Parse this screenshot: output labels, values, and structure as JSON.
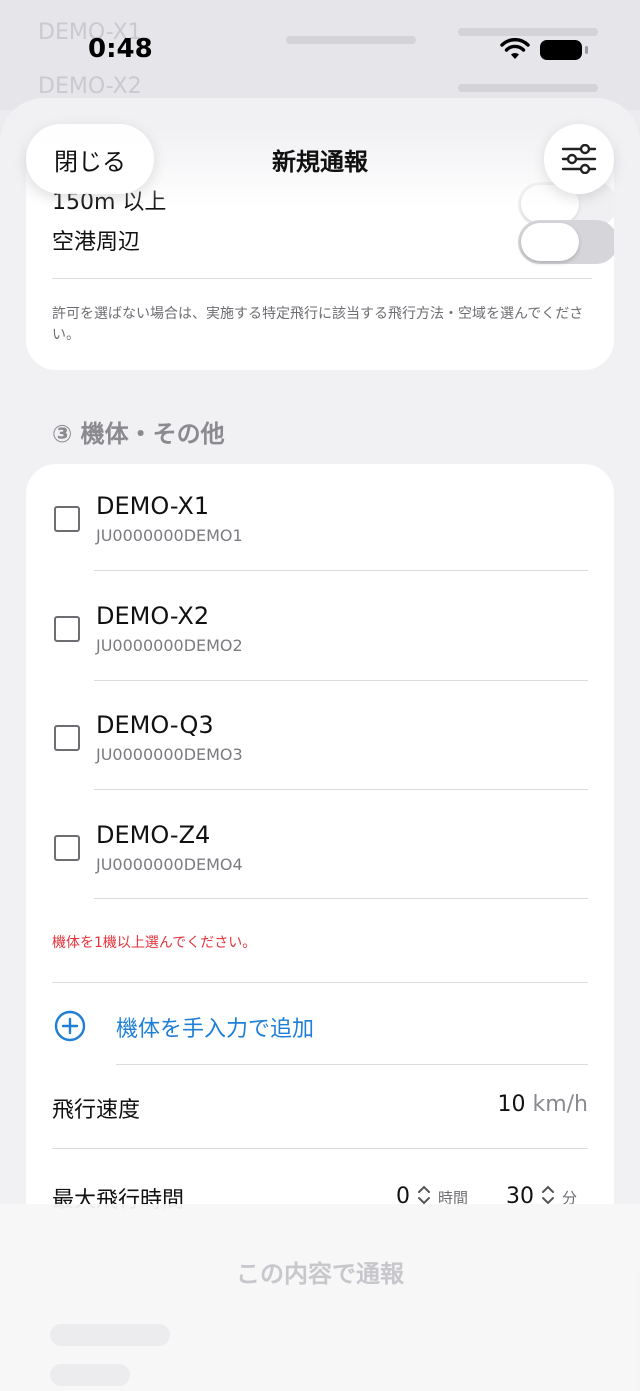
{
  "status": {
    "time": "0:48"
  },
  "background": {
    "row1": "DEMO-X1",
    "row2": "DEMO-X2"
  },
  "header": {
    "close_label": "閉じる",
    "title": "新規通報",
    "filter_icon": "sliders-icon"
  },
  "permits": {
    "items": [
      {
        "label": "150m 以上",
        "on": false
      },
      {
        "label": "空港周辺",
        "on": false
      }
    ],
    "note": "許可を選ばない場合は、実施する特定飛行に該当する飛行方法・空域を選んでください。"
  },
  "aircraft_section": {
    "title": "③ 機体・その他",
    "items": [
      {
        "name": "DEMO-X1",
        "id": "JU0000000DEMO1",
        "checked": false
      },
      {
        "name": "DEMO-X2",
        "id": "JU0000000DEMO2",
        "checked": false
      },
      {
        "name": "DEMO-Q3",
        "id": "JU0000000DEMO3",
        "checked": false
      },
      {
        "name": "DEMO-Z4",
        "id": "JU0000000DEMO4",
        "checked": false
      }
    ],
    "error": "機体を1機以上選んでください。",
    "add_label": "機体を手入力で追加",
    "speed": {
      "label": "飛行速度",
      "value": "10",
      "unit": "km/h"
    },
    "max_time": {
      "label": "最大飛行時間",
      "hours": "0",
      "hours_unit": "時間",
      "minutes": "30",
      "minutes_unit": "分"
    }
  },
  "submit": {
    "label": "この内容で通報"
  },
  "colors": {
    "accent": "#1f7fd6",
    "error": "#e5333b",
    "disabled": "#c7c7cc"
  }
}
